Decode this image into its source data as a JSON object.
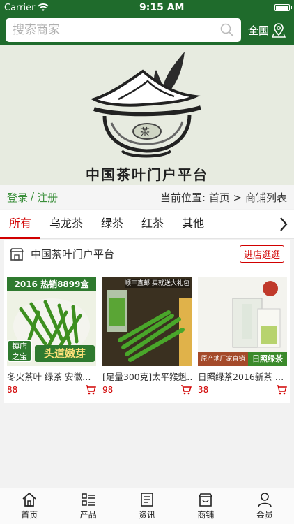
{
  "status_bar": {
    "carrier": "Carrier",
    "time": "9:15 AM",
    "battery_level": 1.0
  },
  "header": {
    "search_placeholder": "搜索商家",
    "city_label": "全国"
  },
  "banner": {
    "title": "中国茶叶门户平台"
  },
  "auth": {
    "login": "登录",
    "separator": "/",
    "register": "注册"
  },
  "breadcrumb": {
    "prefix": "当前位置:",
    "home": "首页",
    "sep": ">",
    "current": "商铺列表"
  },
  "category_tabs": [
    {
      "label": "所有",
      "active": true
    },
    {
      "label": "乌龙茶",
      "active": false
    },
    {
      "label": "绿茶",
      "active": false
    },
    {
      "label": "红茶",
      "active": false
    },
    {
      "label": "其他",
      "active": false
    }
  ],
  "store": {
    "name": "中国茶叶门户平台",
    "visit_label": "进店逛逛",
    "products": [
      {
        "name": "冬火茶叶 绿茶 安徽…",
        "price": "88",
        "img_text_top": "2016 热销8899盒",
        "img_text_badge": "镇店之宝",
        "img_text_bottom": "头道嫩芽"
      },
      {
        "name": "[足量300克]太平猴魁…",
        "price": "98",
        "img_text_top": "顺丰直邮 买就送大礼包"
      },
      {
        "name": "日照绿茶2016新茶 …",
        "price": "38",
        "img_text_bottom_left": "原产地厂家直销",
        "img_text_bottom_right": "日照绿茶"
      }
    ]
  },
  "bottom_nav": [
    {
      "label": "首页",
      "icon": "home-icon"
    },
    {
      "label": "产品",
      "icon": "list-icon"
    },
    {
      "label": "资讯",
      "icon": "news-icon"
    },
    {
      "label": "商铺",
      "icon": "shop-icon"
    },
    {
      "label": "会员",
      "icon": "user-icon"
    }
  ],
  "colors": {
    "brand_green": "#1f6b2c",
    "accent_red": "#d10000",
    "link_green": "#3a8f3a"
  }
}
